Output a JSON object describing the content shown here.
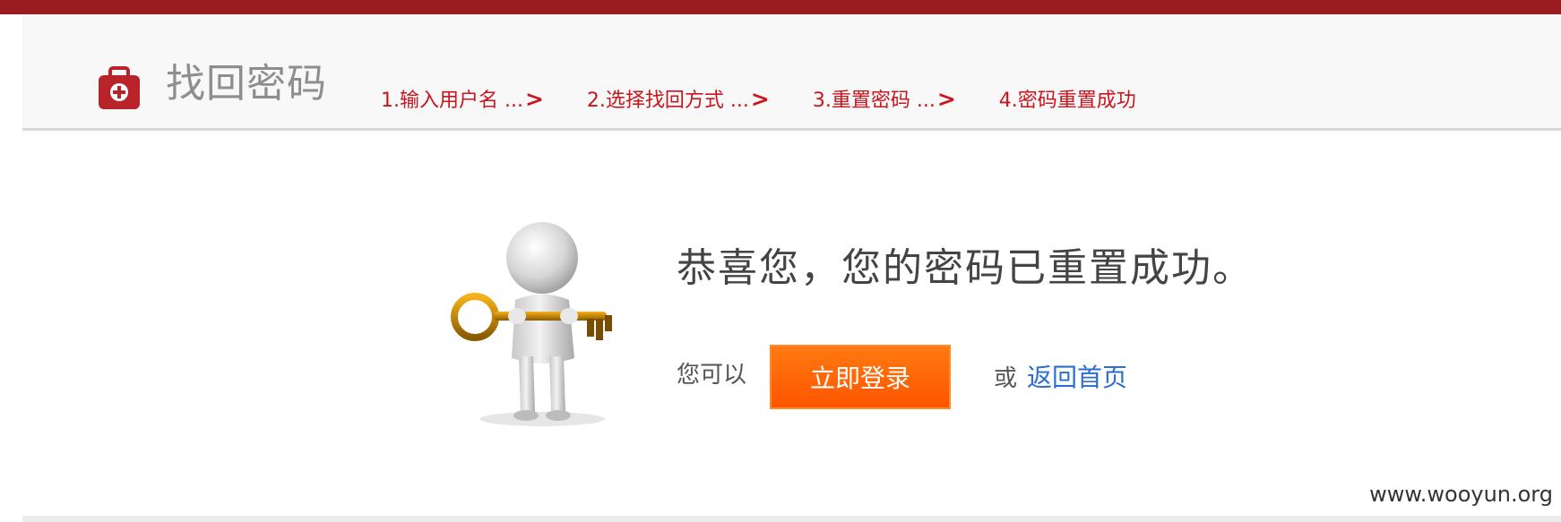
{
  "header": {
    "title": "找回密码",
    "logo_icon": "medical-kit-icon",
    "accent_color": "#9b1c20",
    "steps": [
      {
        "label": "1.输入用户名 ...",
        "arrow": ">"
      },
      {
        "label": "2.选择找回方式 ...",
        "arrow": ">"
      },
      {
        "label": "3.重置密码 ...",
        "arrow": ">"
      },
      {
        "label": "4.密码重置成功",
        "arrow": ""
      }
    ],
    "step_color": "#c9151e"
  },
  "main": {
    "illustration": "person-holding-key-icon",
    "heading": "恭喜您，您的密码已重置成功。",
    "prefix": "您可以",
    "login_button": "立即登录",
    "or_text": "或",
    "home_link": "返回首页",
    "button_color": "#ff6600",
    "link_color": "#2a6ed1"
  },
  "watermark": "www.wooyun.org"
}
